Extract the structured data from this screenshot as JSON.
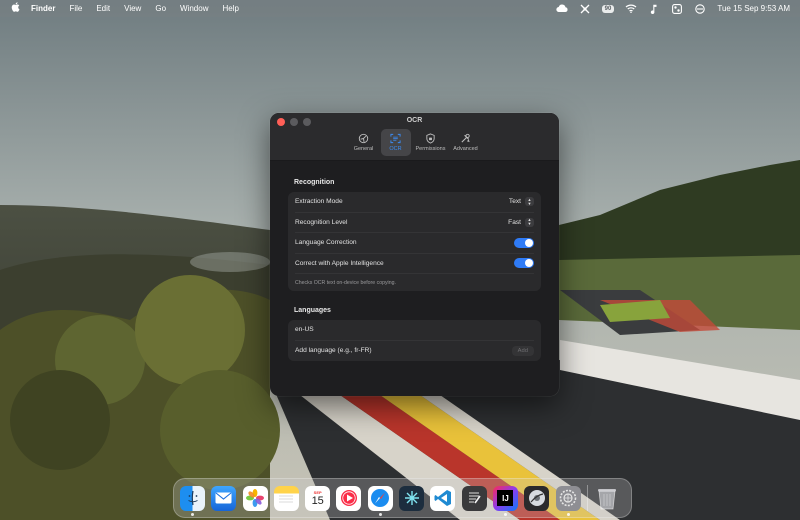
{
  "menubar": {
    "app_name": "Finder",
    "menus": [
      "File",
      "Edit",
      "View",
      "Go",
      "Window",
      "Help"
    ],
    "battery_label": "90",
    "clock": "Tue 15 Sep  9:53 AM",
    "status_icons": [
      "creative-cloud-icon",
      "grid-icon",
      "battery-icon",
      "wifi-icon",
      "music-note-icon",
      "control-center-icon",
      "user-switch-icon"
    ]
  },
  "window": {
    "title": "OCR",
    "tabs": [
      {
        "label": "General",
        "icon": "gear-icon",
        "selected": false
      },
      {
        "label": "OCR",
        "icon": "text-scan-icon",
        "selected": true
      },
      {
        "label": "Permissions",
        "icon": "shield-icon",
        "selected": false
      },
      {
        "label": "Advanced",
        "icon": "tools-icon",
        "selected": false
      }
    ],
    "recognition": {
      "title": "Recognition",
      "extraction_mode_label": "Extraction Mode",
      "extraction_mode_value": "Text",
      "recognition_level_label": "Recognition Level",
      "recognition_level_value": "Fast",
      "language_correction_label": "Language Correction",
      "language_correction_on": true,
      "apple_intelligence_label": "Correct with Apple Intelligence",
      "apple_intelligence_on": true,
      "note": "Checks OCR text on-device before copying."
    },
    "languages": {
      "title": "Languages",
      "items": [
        "en-US"
      ],
      "add_placeholder": "Add language (e.g., fr-FR)",
      "add_button": "Add"
    }
  },
  "dock": {
    "apps": [
      "Finder",
      "Mail",
      "Photos",
      "Notes",
      "Calendar",
      "Music",
      "Safari",
      "Perplexity",
      "Visual Studio Code",
      "TextEdit",
      "IntelliJ IDEA",
      "Disk Utility",
      "System Settings",
      "Trash"
    ],
    "calendar_day": "15",
    "calendar_month": "SEP",
    "intellij_label": "IJ"
  },
  "colors": {
    "accent": "#2f7bf6",
    "window_bg": "#1e1e20",
    "close_button": "#ff5f57"
  }
}
